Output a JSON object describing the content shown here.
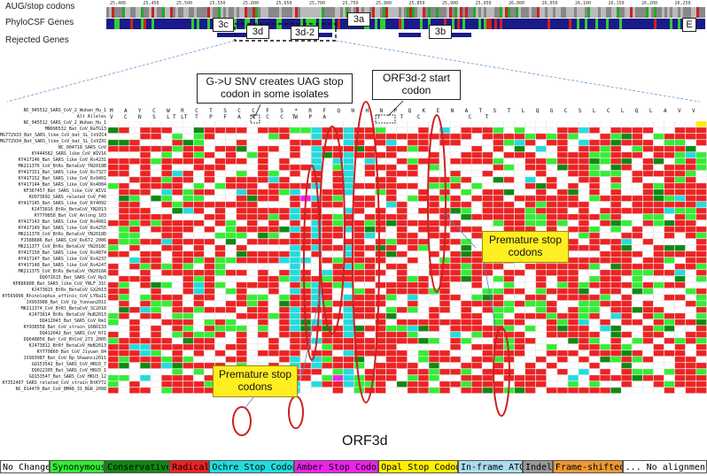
{
  "tracks": {
    "aug_stop": "AUG/stop codons",
    "phylocsf": "PhyloCSF Genes",
    "rejected": "Rejected Genes"
  },
  "ruler": [
    "25,400",
    "25,450",
    "25,500",
    "25,550",
    "25,600",
    "25,650",
    "25,700",
    "25,750",
    "25,800",
    "25,850",
    "25,900",
    "25,950",
    "26,000",
    "26,050",
    "26,100",
    "26,150",
    "26,200",
    "26,250"
  ],
  "genes": {
    "g3c": "3c",
    "g3d": "3d",
    "g3d2": "3d-2",
    "g3a": "3a",
    "g3b": "3b",
    "gE": "E"
  },
  "callouts": {
    "snv": "G->U SNV creates UAG stop codon in some isolates",
    "orf3d2": "ORF3d-2 start codon",
    "premature_right": "Premature stop codons",
    "premature_left": "Premature stop codons",
    "orf3d": "ORF3d"
  },
  "alignment": {
    "ref_aa": "M A Y C W R C T S C C F S * R F Q N H N P Q K E N A T S T L Q G C S L C L Q L A V V V C N S L L T P F A R C C W P A",
    "alt_alleles_label": "Alt Alleles",
    "ref_label": "NC_045512_SARS_CoV_2_Wuhan_Hu_1",
    "alt_marks": "T T           T      T              T   T  C        C  T",
    "sequences": [
      "NC_045512_SARS_CoV_2_Wuhan_Hu_1",
      "MN996532_Bat_CoV_RaTG13",
      "MG772933_Bat_SARS_like_CoV_bat_SL_CoVZC45",
      "MG772934_Bat_SARS_like_CoV_bat_SL_CoVZXC21",
      "NC_004718_SARS_CoV",
      "KY444582_SARS_like_CoV_WIV16",
      "KY417146_Bat_SARS_like_CoV_Rs4231",
      "MK211376_CoV_BtRs_BetaCoV_YN2018B",
      "KY417151_Bat_SARS_like_CoV_Rs7327",
      "KY417152_Bat_SARS_like_CoV_Rs9401",
      "KY417144_Bat_SARS_like_CoV_Rs4084",
      "KF367457_Bat_SARS_like_CoV_WIV1",
      "KU973692_SARS_related_CoV_F46",
      "KY417145_Bat_SARS_like_CoV_Rf4092",
      "KJ473816_BtRs_BetaCoV_YN2013",
      "KY770858_Bat_CoV_Anlong_103",
      "KY417143_Bat_SARS_like_CoV_Rs4081",
      "KY417149_Bat_SARS_like_CoV_Rs4255",
      "MK211378_CoV_BtRs_BetaCoV_YN2018D",
      "FJ588686_Bat_SARS_CoV_Rs672_2006",
      "MK211377_CoV_BtRs_BetaCoV_YN2018C",
      "KY417150_Bat_SARS_like_CoV_Rs4874",
      "KY417147_Bat_SARS_like_CoV_Rs4237",
      "KY417148_Bat_SARS_like_CoV_Rs4247",
      "MK211375_CoV_BtRs_BetaCoV_YN2018A",
      "DQ071615_Bat_SARS_CoV_Rp3",
      "KP886808_Bat_SARS_like_CoV_YNLF_31C",
      "KJ473815_BtRs_BetaCoV_GX2013",
      "KY569996_Rhinolophus_affinis_CoV_LYRa11",
      "JX993988_Bat_CoV_Cp_Yunnan2011",
      "MK211374_CoV_BtRl_BetaCoV_SC2018",
      "KJ473814_BtRs_BetaCoV_HuB2013",
      "DQ412043_Bat_SARS_CoV_Rm1",
      "KY938558_Bat_CoV_strain_16BO133",
      "DQ412042_Bat_SARS_CoV_Rf1",
      "DQ648856_Bat_CoV_BtCoV_273_2005",
      "KJ473812_BtRf_BetaCoV_HeB2013",
      "KY770860_Bat_CoV_Jiyuan_84",
      "JX993987_Bat_CoV_Rp_Shaanxi2011",
      "GQ153542_Bat_SARS_CoV_HKU3_7",
      "DQ022305_Bat_SARS_CoV_HKU3_1",
      "GQ153547_Bat_SARS_CoV_HKU3_12",
      "KY352407_SARS_related_CoV_strain_BtKY72",
      "NC_014470_Bat_CoV_BM48_31_BGR_2008"
    ]
  },
  "legend": [
    {
      "label": "No Change",
      "color": "#ffffff"
    },
    {
      "label": "Synonymous",
      "color": "#33ee33"
    },
    {
      "label": "Conservative",
      "color": "#118811"
    },
    {
      "label": "Radical",
      "color": "#ee2222"
    },
    {
      "label": "Ochre Stop Codon",
      "color": "#22dddd"
    },
    {
      "label": "Amber Stop Codon",
      "color": "#ee22ee"
    },
    {
      "label": "Opal Stop Codon",
      "color": "#ffee00"
    },
    {
      "label": "In-frame ATG",
      "color": "#aaddee"
    },
    {
      "label": "Indel",
      "color": "#999999"
    },
    {
      "label": "Frame-shifted",
      "color": "#ee9933"
    },
    {
      "label": "... No alignment",
      "color": "#ffffff"
    }
  ],
  "colors": {
    "synonymous": "#33ee33",
    "conservative": "#118811",
    "radical": "#ee2222",
    "ochre": "#22dddd",
    "amber": "#ee22ee",
    "opal": "#ffee00",
    "atg": "#aaddee",
    "highlight_oval": "#cc2222",
    "phylocsf": "#1a1a8a"
  }
}
